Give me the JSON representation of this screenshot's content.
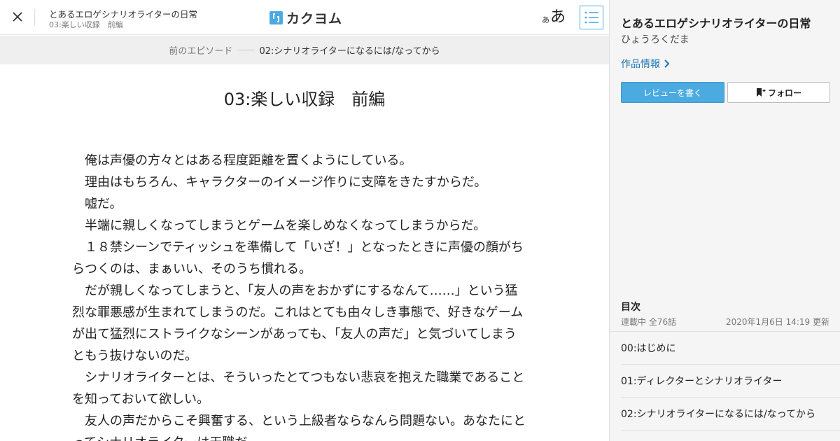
{
  "header": {
    "work_title": "とあるエロゲシナリオライターの日常",
    "episode_title": "03:楽しい収録　前編",
    "logo_text": "カクヨム",
    "font_small": "あ",
    "font_large": "あ"
  },
  "prev_episode": {
    "label": "前のエピソード",
    "title": "02:シナリオライターになるには/なってから"
  },
  "episode": {
    "title": "03:楽しい収録　前編",
    "lines": [
      "　俺は声優の方々とはある程度距離を置くようにしている。",
      "　理由はもちろん、キャラクターのイメージ作りに支障をきたすからだ。",
      "　嘘だ。",
      "　半端に親しくなってしまうとゲームを楽しめなくなってしまうからだ。",
      "　１８禁シーンでティッシュを準備して「いざ！」となったときに声優の顔がち",
      "らつくのは、まぁいい、そのうち慣れる。",
      "　だが親しくなってしまうと、「友人の声をおかずにするなんて……」という猛",
      "烈な罪悪感が生まれてしまうのだ。これはとても由々しき事態で、好きなゲーム",
      "が出て猛烈にストライクなシーンがあっても、「友人の声だ」と気づいてしまう",
      "ともう抜けないのだ。",
      "　シナリオライターとは、そういったとてつもない悲哀を抱えた職業であること",
      "を知っておいて欲しい。",
      "　友人の声だからこそ興奮する、という上級者ならなんら問題ない。あなたにと",
      "ってシナリオライターは天職だ。"
    ]
  },
  "sidebar": {
    "work_title": "とあるエロゲシナリオライターの日常",
    "author": "ひょうろくだま",
    "work_info_label": "作品情報",
    "review_button": "レビューを書く",
    "follow_button": "フォロー",
    "toc": {
      "label": "目次",
      "status": "連載中 全76話",
      "updated": "2020年1月6日 14:19 更新",
      "items": [
        "00:はじめに",
        "01:ディレクターとシナリオライター",
        "02:シナリオライターになるには/なってから"
      ]
    }
  },
  "colors": {
    "accent": "#4baae0",
    "link": "#1f77b4",
    "sidebar_bg": "#f5f5f5",
    "prevbar_bg": "#efefef"
  },
  "icons": [
    "close-icon",
    "kakuyomu-logo-icon",
    "toc-list-icon",
    "chevron-right-icon",
    "bookmark-plus-icon"
  ]
}
